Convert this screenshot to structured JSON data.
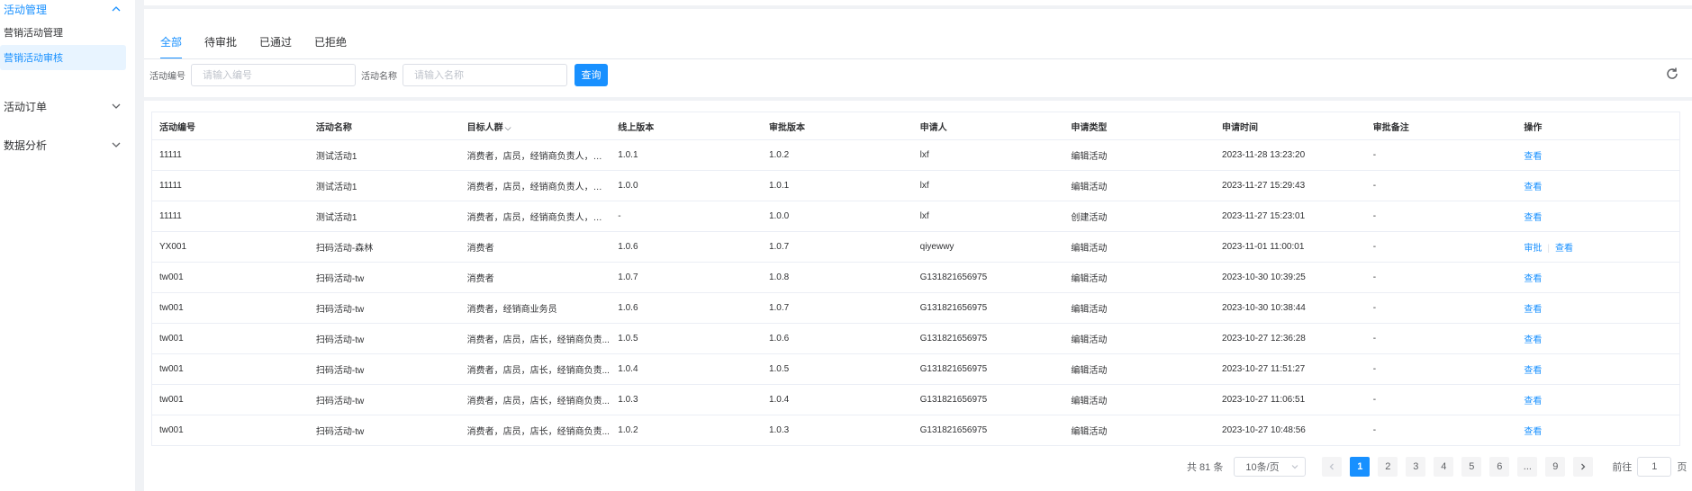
{
  "sidebar": {
    "groups": [
      {
        "label": "活动管理",
        "expanded": true
      },
      {
        "label": "活动订单",
        "expanded": false
      },
      {
        "label": "数据分析",
        "expanded": false
      }
    ],
    "items": [
      {
        "label": "营销活动管理"
      },
      {
        "label": "营销活动审核",
        "active": true
      }
    ]
  },
  "tabs": [
    {
      "label": "全部",
      "active": true
    },
    {
      "label": "待审批"
    },
    {
      "label": "已通过"
    },
    {
      "label": "已拒绝"
    }
  ],
  "filters": {
    "code_label": "活动编号",
    "code_placeholder": "请输入编号",
    "name_label": "活动名称",
    "name_placeholder": "请输入名称",
    "query_label": "查询"
  },
  "table": {
    "headers": [
      "活动编号",
      "活动名称",
      "目标人群",
      "线上版本",
      "审批版本",
      "申请人",
      "申请类型",
      "申请时间",
      "审批备注",
      "操作"
    ],
    "rows": [
      {
        "code": "11111",
        "name": "测试活动1",
        "target": "消费者，店员，经销商负责人，店长",
        "online": "1.0.1",
        "approve": "1.0.2",
        "applicant": "lxf",
        "type": "编辑活动",
        "time": "2023-11-28 13:23:20",
        "remark": "-",
        "ops": [
          "查看"
        ]
      },
      {
        "code": "11111",
        "name": "测试活动1",
        "target": "消费者，店员，经销商负责人，店长",
        "online": "1.0.0",
        "approve": "1.0.1",
        "applicant": "lxf",
        "type": "编辑活动",
        "time": "2023-11-27 15:29:43",
        "remark": "-",
        "ops": [
          "查看"
        ]
      },
      {
        "code": "11111",
        "name": "测试活动1",
        "target": "消费者，店员，经销商负责人，店长",
        "online": "-",
        "approve": "1.0.0",
        "applicant": "lxf",
        "type": "创建活动",
        "time": "2023-11-27 15:23:01",
        "remark": "-",
        "ops": [
          "查看"
        ]
      },
      {
        "code": "YX001",
        "name": "扫码活动-森林",
        "target": "消费者",
        "online": "1.0.6",
        "approve": "1.0.7",
        "applicant": "qiyewwy",
        "type": "编辑活动",
        "time": "2023-11-01 11:00:01",
        "remark": "-",
        "ops": [
          "审批",
          "查看"
        ]
      },
      {
        "code": "tw001",
        "name": "扫码活动-tw",
        "target": "消费者",
        "online": "1.0.7",
        "approve": "1.0.8",
        "applicant": "G131821656975",
        "type": "编辑活动",
        "time": "2023-10-30 10:39:25",
        "remark": "-",
        "ops": [
          "查看"
        ]
      },
      {
        "code": "tw001",
        "name": "扫码活动-tw",
        "target": "消费者，经销商业务员",
        "online": "1.0.6",
        "approve": "1.0.7",
        "applicant": "G131821656975",
        "type": "编辑活动",
        "time": "2023-10-30 10:38:44",
        "remark": "-",
        "ops": [
          "查看"
        ]
      },
      {
        "code": "tw001",
        "name": "扫码活动-tw",
        "target": "消费者，店员，店长，经销商负责...",
        "online": "1.0.5",
        "approve": "1.0.6",
        "applicant": "G131821656975",
        "type": "编辑活动",
        "time": "2023-10-27 12:36:28",
        "remark": "-",
        "ops": [
          "查看"
        ]
      },
      {
        "code": "tw001",
        "name": "扫码活动-tw",
        "target": "消费者，店员，店长，经销商负责...",
        "online": "1.0.4",
        "approve": "1.0.5",
        "applicant": "G131821656975",
        "type": "编辑活动",
        "time": "2023-10-27 11:51:27",
        "remark": "-",
        "ops": [
          "查看"
        ]
      },
      {
        "code": "tw001",
        "name": "扫码活动-tw",
        "target": "消费者，店员，店长，经销商负责...",
        "online": "1.0.3",
        "approve": "1.0.4",
        "applicant": "G131821656975",
        "type": "编辑活动",
        "time": "2023-10-27 11:06:51",
        "remark": "-",
        "ops": [
          "查看"
        ]
      },
      {
        "code": "tw001",
        "name": "扫码活动-tw",
        "target": "消费者，店员，店长，经销商负责...",
        "online": "1.0.2",
        "approve": "1.0.3",
        "applicant": "G131821656975",
        "type": "编辑活动",
        "time": "2023-10-27 10:48:56",
        "remark": "-",
        "ops": [
          "查看"
        ]
      }
    ]
  },
  "pagination": {
    "total_label": "共 81 条",
    "page_size": "10条/页",
    "pages": [
      "1",
      "2",
      "3",
      "4",
      "5",
      "6",
      "...",
      "9"
    ],
    "current": "1",
    "goto_label": "前往",
    "goto_value": "1",
    "page_unit": "页"
  },
  "colors": {
    "accent": "#1890ff",
    "active_bg": "#e8f4ff"
  },
  "icons": {
    "collapse": "chevron-up-icon",
    "expand": "chevron-down-icon",
    "refresh": "refresh-icon",
    "prev": "chevron-left-icon",
    "next": "chevron-right-icon"
  }
}
